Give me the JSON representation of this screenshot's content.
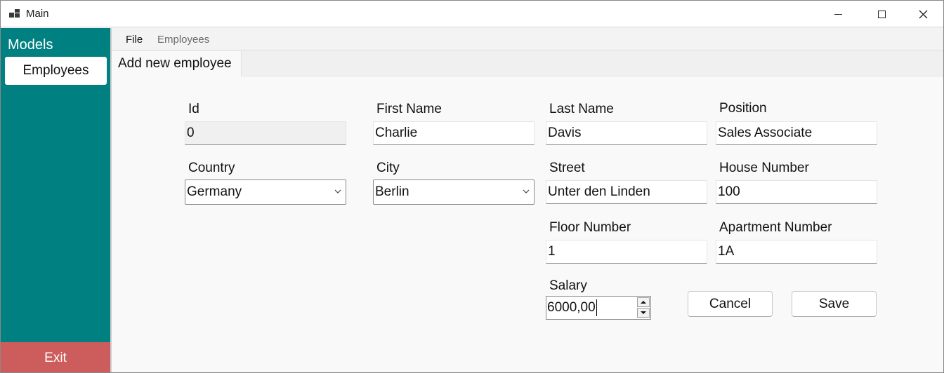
{
  "window": {
    "title": "Main"
  },
  "sidebar": {
    "title": "Models",
    "items": [
      {
        "label": "Employees",
        "selected": true
      }
    ],
    "exit_label": "Exit"
  },
  "menu": {
    "items": [
      "File",
      "Employees"
    ]
  },
  "tabs": [
    {
      "label": "Add new employee",
      "active": true
    }
  ],
  "form": {
    "id": {
      "label": "Id",
      "value": "0"
    },
    "first_name": {
      "label": "First Name",
      "value": "Charlie"
    },
    "last_name": {
      "label": "Last Name",
      "value": "Davis"
    },
    "position": {
      "label": "Position",
      "value": "Sales Associate"
    },
    "country": {
      "label": "Country",
      "value": "Germany"
    },
    "city": {
      "label": "City",
      "value": "Berlin"
    },
    "street": {
      "label": "Street",
      "value": "Unter den Linden"
    },
    "house_number": {
      "label": "House Number",
      "value": "100"
    },
    "floor_number": {
      "label": "Floor Number",
      "value": "1"
    },
    "apartment_number": {
      "label": "Apartment Number",
      "value": "1A"
    },
    "salary": {
      "label": "Salary",
      "value": "6000,00"
    },
    "cancel_label": "Cancel",
    "save_label": "Save"
  },
  "colors": {
    "sidebar_bg": "#008080",
    "exit_bg": "#cd5c5c",
    "window_bg": "#f3f3f3"
  }
}
